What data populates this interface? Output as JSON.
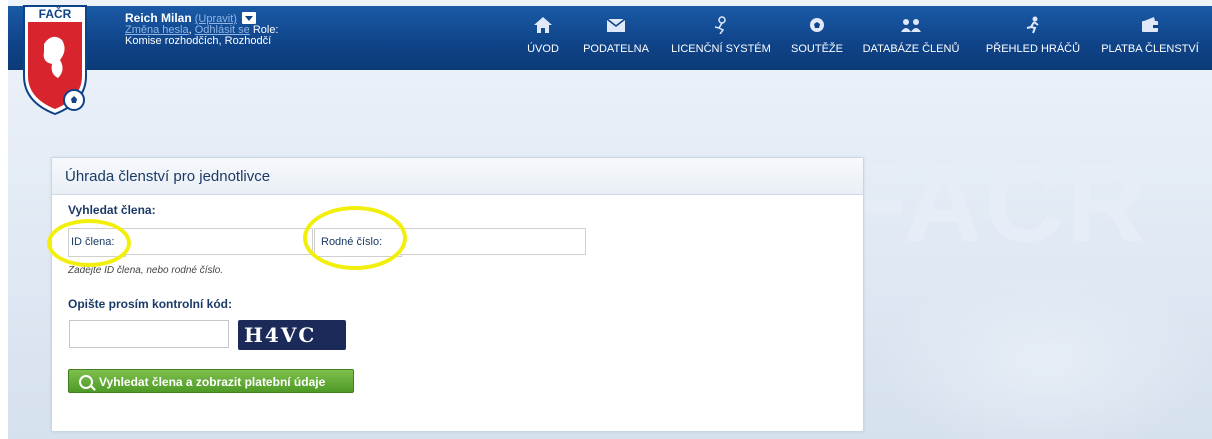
{
  "header": {
    "user_name": "Reich Milan",
    "edit_link": "(Upravit)",
    "change_password": "Změna hesla",
    "logout": "Odhlásit se",
    "role_label": "Role:",
    "role_value": "Komise rozhodčích, Rozhodčí",
    "logo_text": "FAČR"
  },
  "nav": [
    {
      "label": "ÚVOD",
      "icon": "home-icon"
    },
    {
      "label": "PODATELNA",
      "icon": "mail-icon"
    },
    {
      "label": "LICENČNÍ SYSTÉM",
      "icon": "licence-icon"
    },
    {
      "label": "SOUTĚŽE",
      "icon": "ball-icon"
    },
    {
      "label": "DATABÁZE ČLENŮ",
      "icon": "members-icon"
    },
    {
      "label": "PŘEHLED HRÁČŮ",
      "icon": "player-icon"
    },
    {
      "label": "PLATBA ČLENSTVÍ",
      "icon": "wallet-icon"
    }
  ],
  "watermark": "FAČR",
  "panel": {
    "title": "Úhrada členství pro jednotlivce",
    "search_heading": "Vyhledat člena:",
    "member_id_label": "ID člena:",
    "birth_number_label": "Rodné číslo:",
    "member_id_value": "",
    "birth_number_value": "",
    "hint": "Zadejte ID člena, nebo rodné číslo.",
    "captcha_heading": "Opište prosím kontrolní kód:",
    "captcha_value": "",
    "captcha_image_text": "H4VC",
    "submit_label": "Vyhledat člena a zobrazit platební údaje"
  },
  "colors": {
    "header_blue": "#0f4388",
    "button_green": "#5aa52f",
    "highlight_yellow": "#f2ef0c"
  }
}
